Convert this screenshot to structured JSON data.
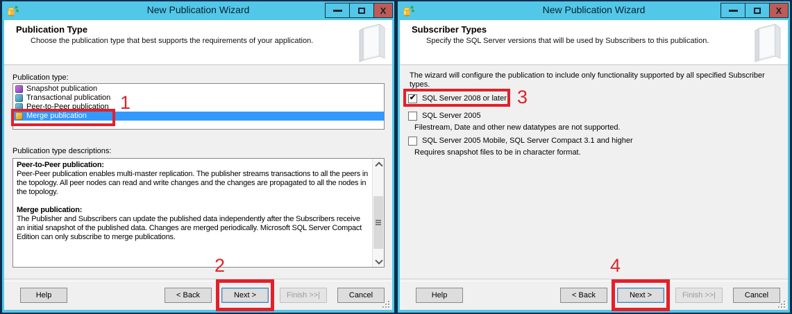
{
  "window": {
    "title": "New Publication Wizard",
    "close_glyph": "X"
  },
  "icons": {
    "check": "✔"
  },
  "buttons": {
    "help": "Help",
    "back": "< Back",
    "next": "Next >",
    "finish": "Finish >>|",
    "cancel": "Cancel"
  },
  "left_dialog": {
    "header": {
      "title": "Publication Type",
      "subtitle": "Choose the publication type that best supports the requirements of your application."
    },
    "publication_type_label": "Publication type:",
    "publication_types": [
      {
        "label": "Snapshot publication",
        "selected": false
      },
      {
        "label": "Transactional publication",
        "selected": false
      },
      {
        "label": "Peer-to-Peer publication",
        "selected": false
      },
      {
        "label": "Merge publication",
        "selected": true
      }
    ],
    "descriptions_label": "Publication type descriptions:",
    "descriptions": [
      {
        "heading": "Peer-to-Peer publication:",
        "body": "Peer-Peer publication enables multi-master replication. The publisher streams transactions to all the peers in the topology. All peer nodes can read and write changes and the changes are propagated to all the nodes in the topology."
      },
      {
        "heading": "Merge publication:",
        "body": "The Publisher and Subscribers can update the published data independently after the Subscribers receive an initial snapshot of the published data. Changes are merged periodically. Microsoft SQL Server Compact Edition can only subscribe to merge publications."
      }
    ],
    "annotations": {
      "selected_type": "1",
      "next_button": "2"
    }
  },
  "right_dialog": {
    "header": {
      "title": "Subscriber Types",
      "subtitle": "Specify the SQL Server versions that will be used by Subscribers to this publication."
    },
    "intro": "The wizard will configure the publication to include only functionality supported by all specified Subscriber types.",
    "subscriber_types": [
      {
        "label": "SQL Server 2008 or later",
        "checked": true,
        "note": ""
      },
      {
        "label": "SQL Server 2005",
        "checked": false,
        "note": "Filestream, Date and other new datatypes are not supported."
      },
      {
        "label": "SQL Server 2005 Mobile, SQL Server Compact 3.1 and higher",
        "checked": false,
        "note": "Requires snapshot files to be in character format."
      }
    ],
    "annotations": {
      "checked_type": "3",
      "next_button": "4"
    }
  },
  "colors": {
    "titlebar": "#53c7e8",
    "selection": "#3399ff",
    "annotation": "#e3202a",
    "close_button": "#bf5b57",
    "body": "#f0f0f0"
  }
}
